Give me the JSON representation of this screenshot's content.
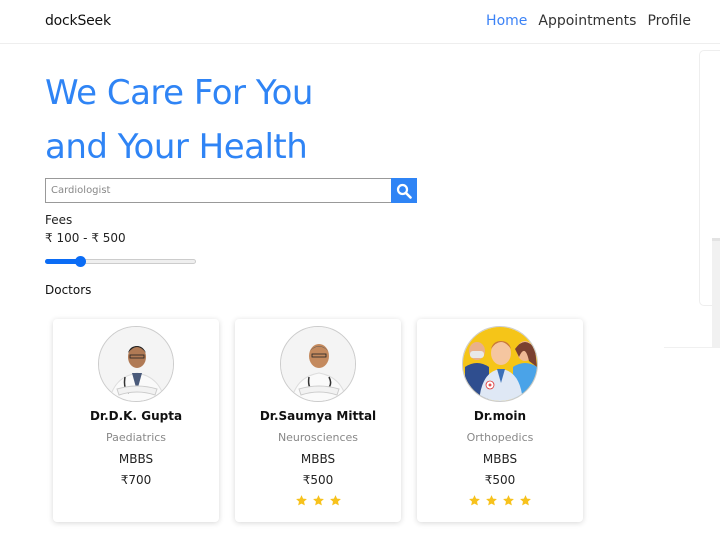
{
  "navbar": {
    "brand": "dockSeek",
    "links": [
      {
        "label": "Home",
        "active": true
      },
      {
        "label": "Appointments",
        "active": false
      },
      {
        "label": "Profile",
        "active": false
      }
    ]
  },
  "hero": {
    "line1": "We Care For You",
    "line2": "and Your Health"
  },
  "search": {
    "placeholder": "Cardiologist",
    "value": "",
    "button_icon": "search-icon"
  },
  "fees": {
    "label": "Fees",
    "range_text": "₹ 100 - ₹ 500",
    "slider_value_fraction": 0.23
  },
  "doctors_section": {
    "title": "Doctors",
    "doctors": [
      {
        "name": "Dr.D.K. Gupta",
        "specialty": "Paediatrics",
        "degree": "MBBS",
        "fee": "₹700",
        "rating": 0,
        "avatar": "doctor-photo"
      },
      {
        "name": "Dr.Saumya Mittal",
        "specialty": "Neurosciences",
        "degree": "MBBS",
        "fee": "₹500",
        "rating": 3,
        "avatar": "doctor-photo"
      },
      {
        "name": "Dr.moin",
        "specialty": "Orthopedics",
        "degree": "MBBS",
        "fee": "₹500",
        "rating": 4,
        "avatar": "doctor-illustration"
      }
    ]
  },
  "colors": {
    "accent": "#2f84f5",
    "slider": "#0b6cf5",
    "star": "#f7c21c",
    "muted_text": "#888888"
  }
}
